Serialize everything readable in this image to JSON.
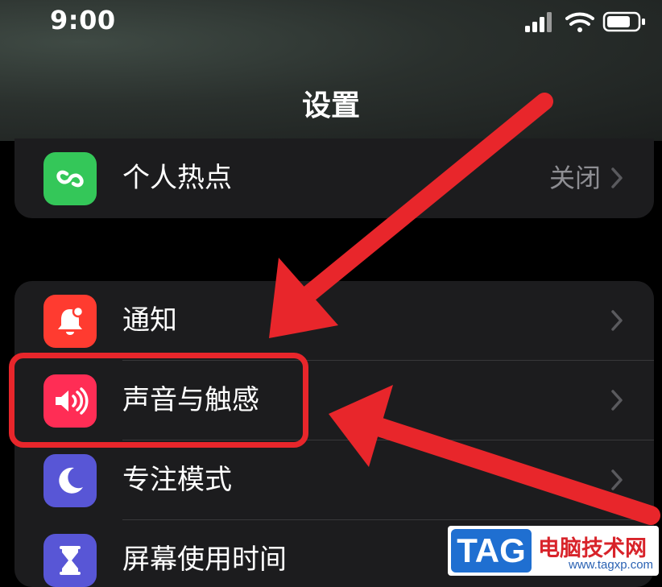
{
  "status_bar": {
    "time": "9:00"
  },
  "nav": {
    "title": "设置"
  },
  "group1": [
    {
      "label": "个人热点",
      "value": "关闭",
      "icon": "link-icon",
      "color": "#34c759"
    }
  ],
  "group2": [
    {
      "label": "通知",
      "icon": "bell-icon",
      "color": "#ff3b30"
    },
    {
      "label": "声音与触感",
      "icon": "speaker-icon",
      "color": "#ff2d55"
    },
    {
      "label": "专注模式",
      "icon": "moon-icon",
      "color": "#5856d6"
    },
    {
      "label": "屏幕使用时间",
      "icon": "hourglass-icon",
      "color": "#5856d6"
    }
  ],
  "watermark": {
    "badge": "TAG",
    "title": "电脑技术网",
    "url": "www.tagxp.com"
  },
  "colors": {
    "annotation": "#e8262b",
    "background": "#000000",
    "cell": "#1c1c1e"
  }
}
